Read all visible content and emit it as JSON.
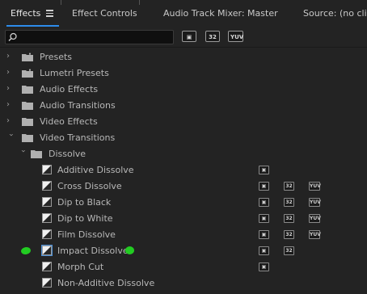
{
  "tabs": [
    {
      "label": "Effects",
      "active": true
    },
    {
      "label": "Effect Controls",
      "active": false
    },
    {
      "label": "Audio Track Mixer: Master",
      "active": false
    },
    {
      "label": "Source: (no clips",
      "active": false
    }
  ],
  "menu_icon": "hamburger-icon",
  "search": {
    "value": "",
    "placeholder": ""
  },
  "filters": {
    "accelerated": "▣",
    "bit32": "32",
    "yuv": "YUV"
  },
  "tree": {
    "presets": "Presets",
    "lumetri_presets": "Lumetri Presets",
    "audio_effects": "Audio Effects",
    "audio_transitions": "Audio Transitions",
    "video_effects": "Video Effects",
    "video_transitions": "Video Transitions",
    "dissolve": "Dissolve",
    "items": [
      {
        "label": "Additive Dissolve",
        "accelerated": true,
        "bit32": false,
        "yuv": false
      },
      {
        "label": "Cross Dissolve",
        "accelerated": true,
        "bit32": true,
        "yuv": true
      },
      {
        "label": "Dip to Black",
        "accelerated": true,
        "bit32": true,
        "yuv": true
      },
      {
        "label": "Dip to White",
        "accelerated": true,
        "bit32": true,
        "yuv": true
      },
      {
        "label": "Film Dissolve",
        "accelerated": true,
        "bit32": true,
        "yuv": true
      },
      {
        "label": "Impact Dissolve",
        "accelerated": true,
        "bit32": true,
        "yuv": false,
        "selected": true
      },
      {
        "label": "Morph Cut",
        "accelerated": true,
        "bit32": false,
        "yuv": false
      },
      {
        "label": "Non-Additive Dissolve",
        "accelerated": false,
        "bit32": false,
        "yuv": false
      }
    ]
  },
  "colors": {
    "accent": "#2d8ceb",
    "highlight_marker": "#22cc22"
  }
}
